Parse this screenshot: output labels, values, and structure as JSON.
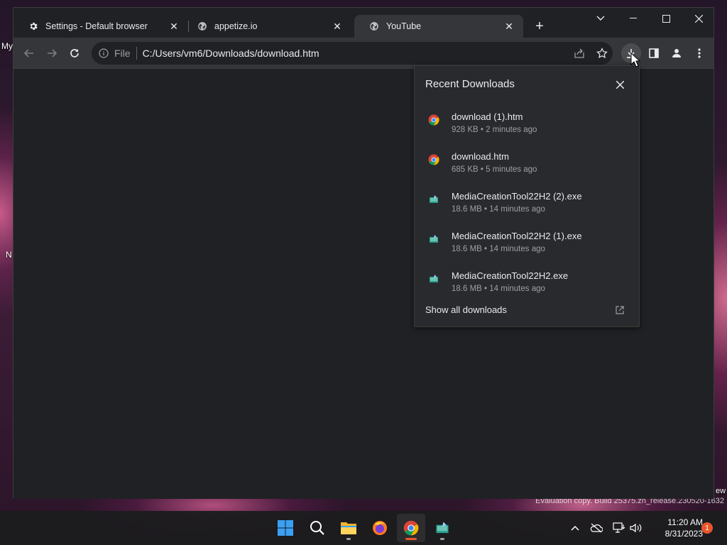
{
  "desktop": {
    "left_labels": [
      "My",
      "N"
    ],
    "watermark": "Evaluation copy. Build 25375.zn_release.230520-1632",
    "right_fragment": "ew"
  },
  "tabs": [
    {
      "title": "Settings - Default browser",
      "icon": "gear-icon",
      "active": false
    },
    {
      "title": "appetize.io",
      "icon": "globe-icon",
      "active": false
    },
    {
      "title": "YouTube",
      "icon": "globe-icon",
      "active": true
    }
  ],
  "toolbar": {
    "scheme": "File",
    "url": "C:/Users/vm6/Downloads/download.htm"
  },
  "downloads": {
    "title": "Recent Downloads",
    "items": [
      {
        "name": "download (1).htm",
        "meta": "928 KB • 2 minutes ago",
        "icon": "chrome-icon"
      },
      {
        "name": "download.htm",
        "meta": "685 KB • 5 minutes ago",
        "icon": "chrome-icon"
      },
      {
        "name": "MediaCreationTool22H2 (2).exe",
        "meta": "18.6 MB • 14 minutes ago",
        "icon": "media-creation-tool-icon"
      },
      {
        "name": "MediaCreationTool22H2 (1).exe",
        "meta": "18.6 MB • 14 minutes ago",
        "icon": "media-creation-tool-icon"
      },
      {
        "name": "MediaCreationTool22H2.exe",
        "meta": "18.6 MB • 14 minutes ago",
        "icon": "media-creation-tool-icon"
      }
    ],
    "show_all": "Show all downloads"
  },
  "taskbar": {
    "apps": [
      "start-icon",
      "search-icon",
      "file-explorer-icon",
      "firefox-icon",
      "chrome-icon",
      "media-creation-tool-icon"
    ],
    "time": "11:20 AM",
    "date": "8/31/2023",
    "notifications": "1"
  },
  "colors": {
    "accent_chrome": "#e8eaed",
    "panel_bg": "#292a2d",
    "frame_bg": "#202124",
    "toolbar_bg": "#35363a",
    "badge": "#e8562a"
  }
}
